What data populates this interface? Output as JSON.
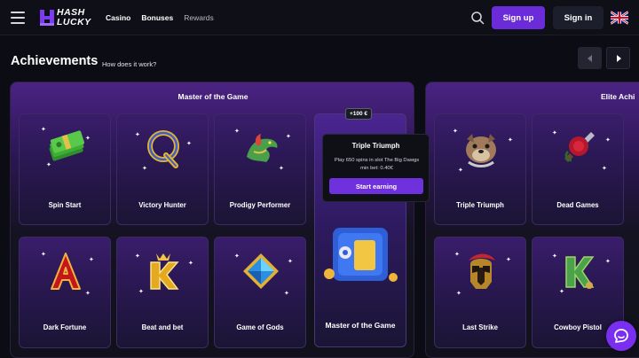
{
  "header": {
    "logo_top": "HASH",
    "logo_bottom": "LUCKY",
    "nav": [
      "Casino",
      "Bonuses",
      "Rewards"
    ],
    "signup_label": "Sign up",
    "signin_label": "Sign in",
    "language_icon": "uk-flag-icon"
  },
  "page": {
    "title": "Achievements",
    "how_link": "How does it work?"
  },
  "panels": [
    {
      "title": "Master of the Game",
      "cards": [
        {
          "name": "Spin Start",
          "icon": "cash-stack-icon"
        },
        {
          "name": "Victory Hunter",
          "icon": "letter-q-icon"
        },
        {
          "name": "Prodigy Performer",
          "icon": "dragon-icon"
        },
        {
          "name": "Dark Fortune",
          "icon": "letter-a-icon"
        },
        {
          "name": "Beat and bet",
          "icon": "letter-k-icon"
        },
        {
          "name": "Game of Gods",
          "icon": "blue-gem-icon"
        }
      ],
      "featured": {
        "name": "Master of the Game",
        "reward": "+100 €",
        "icon": "safe-icon"
      }
    },
    {
      "title": "Elite Achi",
      "cards": [
        {
          "name": "Triple Triumph",
          "icon": "bulldog-icon"
        },
        {
          "name": "Dead Games",
          "icon": "rose-dagger-icon"
        },
        {
          "name": "Last Strike",
          "icon": "spartan-helmet-icon"
        },
        {
          "name": "Cowboy Pistol",
          "icon": "letter-k-icon"
        }
      ]
    }
  ],
  "tooltip": {
    "title": "Triple Triumph",
    "description": "Play 650 spins in slot The Big Dawgs min bet: 0.40€",
    "button": "Start earning"
  },
  "colors": {
    "accent": "#6c2bd9",
    "background": "#0c0d14",
    "chat": "#7a2ff0"
  }
}
